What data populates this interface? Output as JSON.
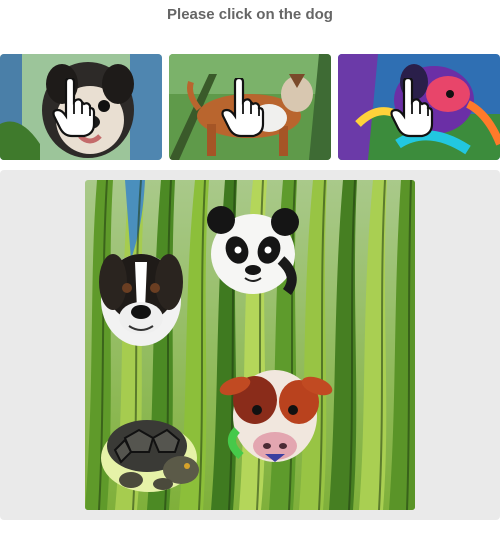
{
  "prompt": {
    "text": "Please click on the dog"
  },
  "examples": [
    {
      "name": "example-dog-pug",
      "subject": "dog",
      "icon": "pointer-hand-icon"
    },
    {
      "name": "example-dog-walking",
      "subject": "dog",
      "icon": "pointer-hand-icon"
    },
    {
      "name": "example-dog-colorful",
      "subject": "dog",
      "icon": "pointer-hand-icon"
    }
  ],
  "challenge": {
    "background": "tall green grass",
    "objects": [
      {
        "name": "dog-head",
        "label": "dog"
      },
      {
        "name": "panda-head",
        "label": "panda"
      },
      {
        "name": "cow-head",
        "label": "cow"
      },
      {
        "name": "tortoise",
        "label": "tortoise"
      }
    ]
  },
  "colors": {
    "prompt_text": "#666666",
    "challenge_background": "#eaeaea",
    "grass_green": "#7fb03a"
  }
}
